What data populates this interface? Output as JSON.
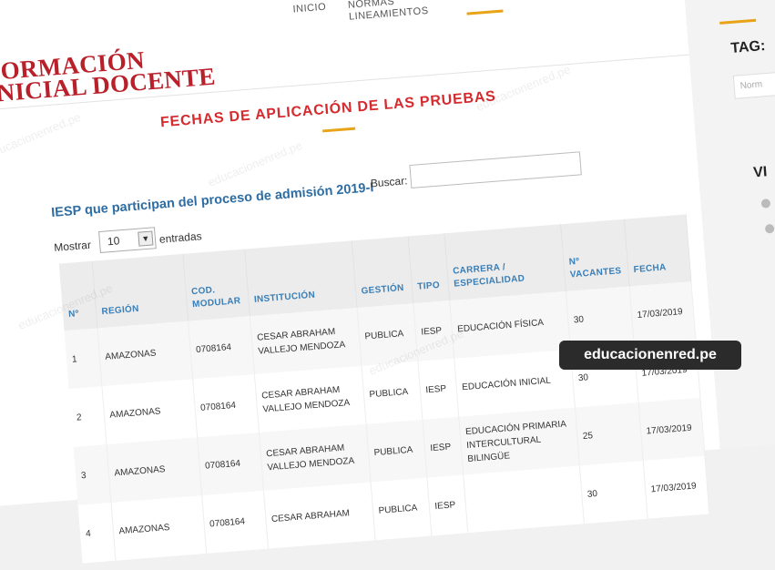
{
  "brand": {
    "logo_line1": "FORMACIÓN",
    "logo_line2": "INICIAL DOCENTE"
  },
  "nav": {
    "items": [
      "INICIO",
      "NORMAS",
      "LINEAMIENTOS"
    ]
  },
  "page": {
    "title": "FECHAS DE APLICACIÓN DE LAS PRUEBAS",
    "subtitle": "IESP que participan del proceso de admisión 2019-I"
  },
  "controls": {
    "search_label": "Buscar:",
    "search_value": "",
    "show_label": "Mostrar",
    "show_value": "10",
    "entries_label": "entradas"
  },
  "table": {
    "headers": [
      "Nº",
      "REGIÓN",
      "COD. MODULAR",
      "INSTITUCIÓN",
      "GESTIÓN",
      "TIPO",
      "CARRERA / ESPECIALIDAD",
      "Nº VACANTES",
      "FECHA"
    ],
    "rows": [
      [
        "1",
        "AMAZONAS",
        "0708164",
        "CESAR ABRAHAM VALLEJO MENDOZA",
        "PUBLICA",
        "IESP",
        "EDUCACIÓN FÍSICA",
        "30",
        "17/03/2019"
      ],
      [
        "2",
        "AMAZONAS",
        "0708164",
        "CESAR ABRAHAM VALLEJO MENDOZA",
        "PUBLICA",
        "IESP",
        "EDUCACIÓN INICIAL",
        "30",
        "17/03/2019"
      ],
      [
        "3",
        "AMAZONAS",
        "0708164",
        "CESAR ABRAHAM VALLEJO MENDOZA",
        "PUBLICA",
        "IESP",
        "EDUCACIÓN PRIMARIA INTERCULTURAL BILINGÜE",
        "25",
        "17/03/2019"
      ],
      [
        "4",
        "AMAZONAS",
        "0708164",
        "CESAR ABRAHAM",
        "PUBLICA",
        "IESP",
        "",
        "30",
        "17/03/2019"
      ]
    ]
  },
  "sidebar": {
    "tag_label": "TAG:",
    "tag_placeholder": "Norm",
    "vi_label": "VI"
  },
  "watermark": {
    "badge": "educacionenred.pe",
    "text": "educacionenred.pe"
  },
  "colors": {
    "brand_red": "#b8202a",
    "title_red": "#d52a2e",
    "accent_gold": "#e8a317",
    "link_blue": "#2d6da3"
  }
}
